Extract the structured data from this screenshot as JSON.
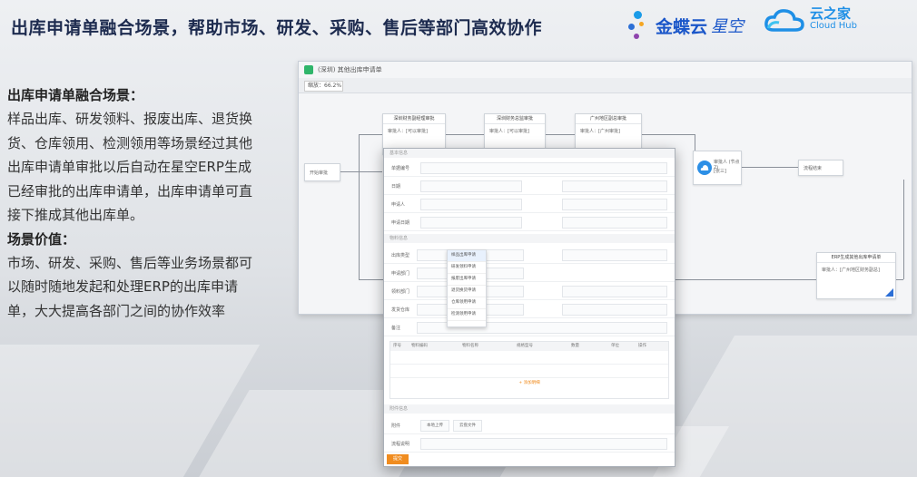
{
  "header": {
    "title": "出库申请单融合场景，帮助市场、研发、采购、售后等部门高效协作",
    "logo_kingdee": "金蝶云",
    "logo_kingdee_suffix": "星空",
    "logo_cloud_cn": "云之家",
    "logo_cloud_en": "Cloud Hub"
  },
  "left_panel": {
    "heading1": "出库申请单融合场景：",
    "para1": "样品出库、研发领料、报废出库、退货换货、仓库领用、检测领用等场景经过其他出库申请单审批以后自动在星空ERP生成已经审批的出库申请单，出库申请单可直接下推成其他出库单。",
    "heading2": "场景价值：",
    "para2": "市场、研发、采购、售后等业务场景都可以随时随地发起和处理ERP的出库申请单，大大提高各部门之间的协作效率"
  },
  "workflow_window": {
    "title": "(深圳) 其他出库申请单",
    "zoom": "缩放：66.2%",
    "start_node": "开始审批",
    "nodes": [
      {
        "header": "深圳财务副经理审批",
        "body": "审批人：[可以审批]"
      },
      {
        "header": "深圳财务总监审批",
        "body": "审批人：[可以审批]"
      },
      {
        "header": "广州地区副总审批",
        "body": "审批人：[广州审批]"
      },
      {
        "header": "审批人 (节点2)",
        "body": "[张三]"
      },
      {
        "header": "ERP生成其他出库申请单",
        "body": "审批人：[广州地区财务副总]"
      }
    ],
    "end_node": "流程结束"
  },
  "form_window": {
    "sections": [
      "基本信息",
      "物料信息",
      "附件信息"
    ],
    "labels": [
      "单据编号",
      "日期",
      "申请人",
      "申请日期",
      "申请组织",
      "申请部门",
      "领料部门",
      "出库类型",
      "发货仓库",
      "备注",
      "附件",
      "流程说明"
    ],
    "dropdown_options": [
      "样品出库申请",
      "研发领料申请",
      "报废出库申请",
      "退货换货申请",
      "仓库领用申请",
      "检测领用申请"
    ],
    "table_headers": [
      "序号",
      "物料编码",
      "物料名称",
      "规格型号",
      "数量",
      "单位",
      "操作"
    ],
    "add_row": "+ 添加明细",
    "upload_btn1": "本地上传",
    "upload_btn2": "云盘文件",
    "submit": "提交"
  },
  "colors": {
    "title": "#1d2b4f",
    "brand_blue": "#1a56c9",
    "cloud_blue": "#1e8fe6",
    "submit_orange": "#f08c1f",
    "node_corner": "#2c6fd6"
  }
}
